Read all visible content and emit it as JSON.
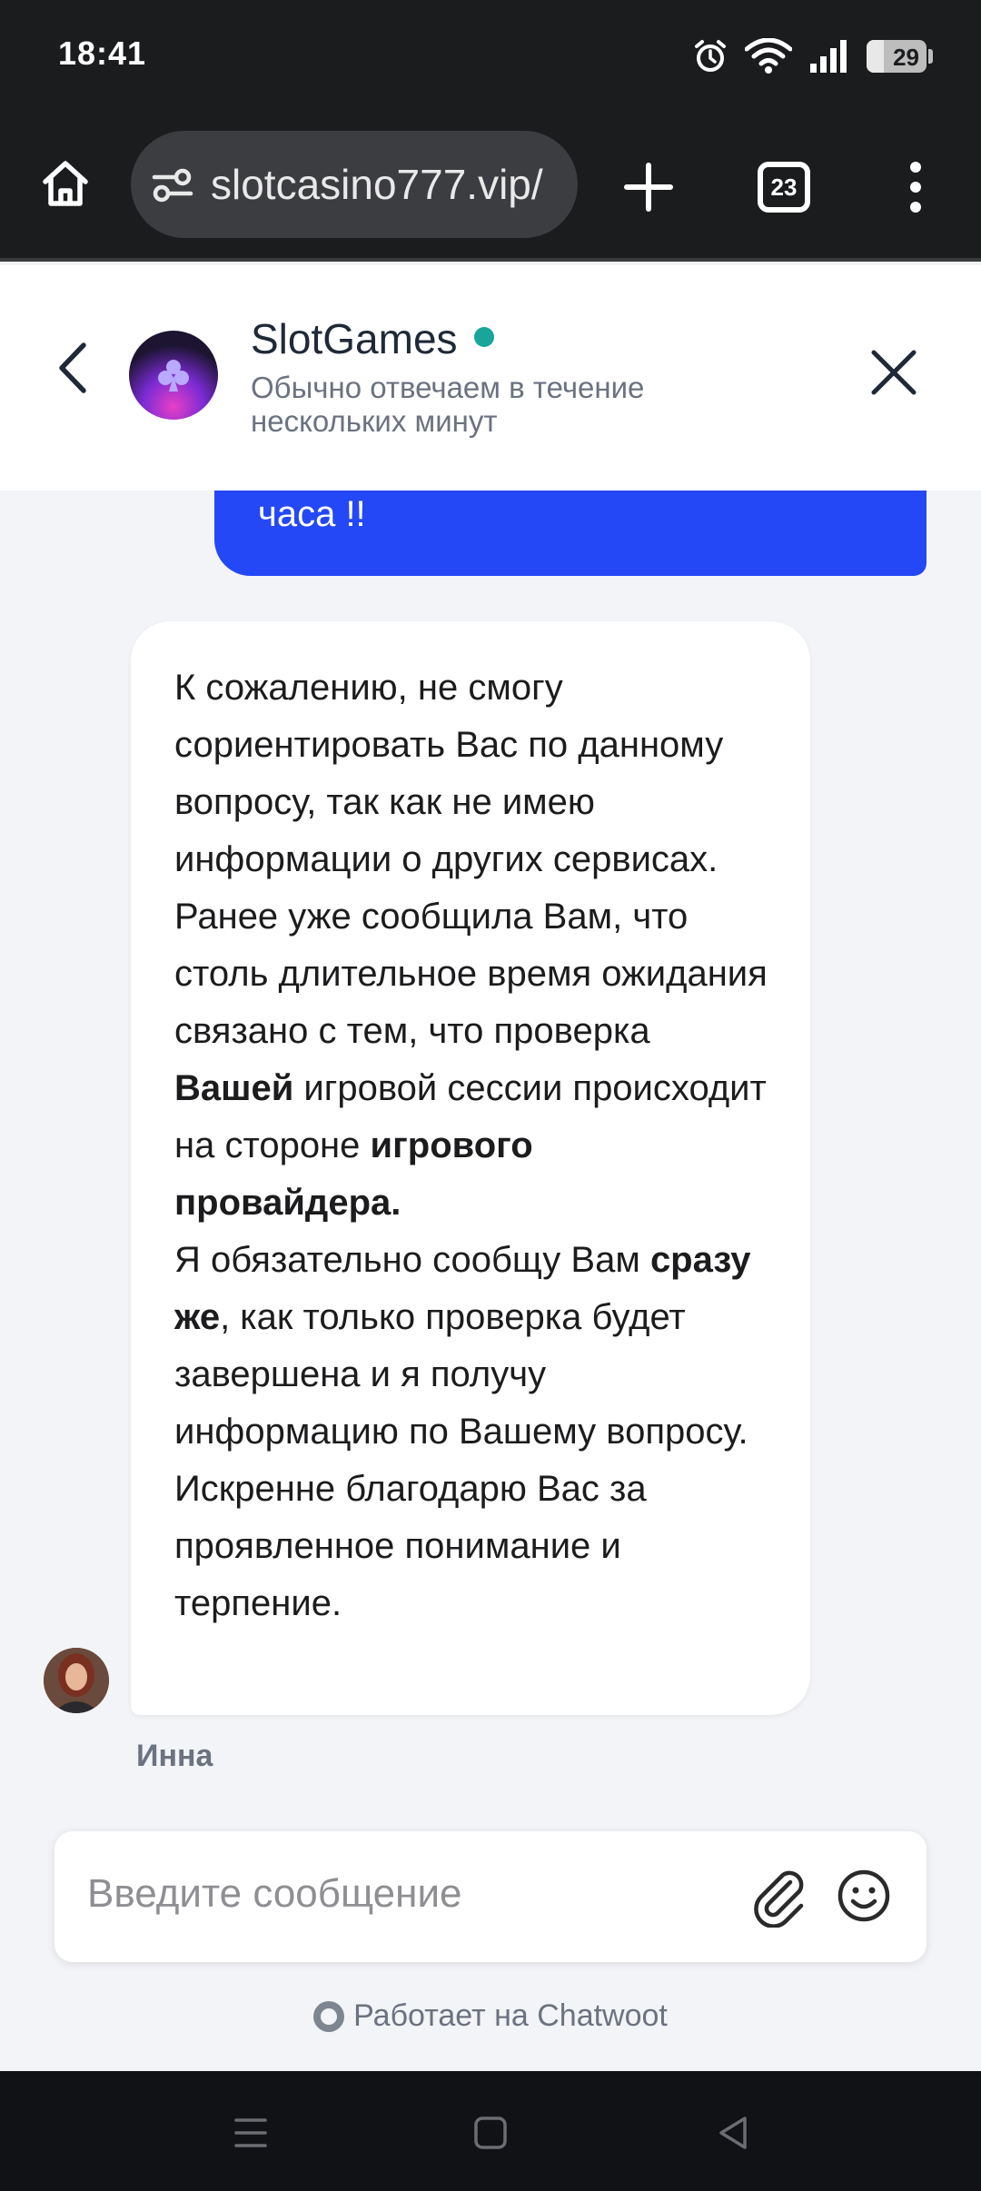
{
  "status_bar": {
    "time": "18:41",
    "battery_level": "29",
    "icons": [
      "alarm-icon",
      "wifi-icon",
      "signal-icon",
      "battery-icon"
    ]
  },
  "browser": {
    "url": "slotcasino777.vip/",
    "tab_count": "23",
    "icons": [
      "home-icon",
      "site-settings-icon",
      "new-tab-icon",
      "tab-switcher-icon",
      "overflow-menu-icon"
    ]
  },
  "chat_header": {
    "title": "SlotGames",
    "subtitle": "Обычно отвечаем в течение нескольких минут",
    "online_color": "#1aa59a"
  },
  "messages": {
    "user_fragment": "часа !!",
    "user_bubble_color": "#2448f5",
    "agent": {
      "p1_a": "К сожалению, не смогу сориентировать Вас по данному вопросу, так как не имею информации о других сервисах.",
      "p2_a": "Ранее уже сообщила Вам, что столь длительное время ожидания связано с тем, что проверка ",
      "p2_b1": "Вашей",
      "p2_c": " игровой сессии происходит на стороне ",
      "p2_b2": "игрового провайдера.",
      "p3_a": "Я обязательно сообщу Вам ",
      "p3_b": "сразу же",
      "p3_c": ", как только проверка будет завершена и я получу информацию по Вашему вопросу.",
      "p4_a": "Искренне благодарю Вас за проявленное понимание и терпение.",
      "name": "Инна"
    }
  },
  "composer": {
    "placeholder": "Введите сообщение"
  },
  "footer": {
    "powered_by": "Работает на Chatwoot"
  },
  "nav_bar": {
    "icons": [
      "recent-apps-icon",
      "home-nav-icon",
      "back-nav-icon"
    ]
  }
}
